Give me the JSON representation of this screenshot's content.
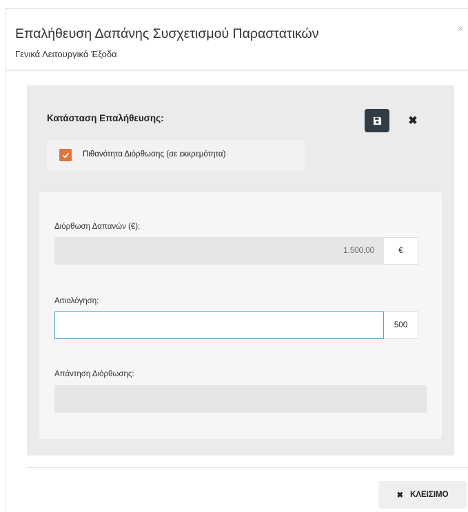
{
  "dialog": {
    "title": "Επαλήθευση Δαπάνης Συσχετισμού Παραστατικών",
    "subtitle": "Γενικά Λειτουργικά Έξοδα",
    "close_glyph": "×"
  },
  "verification": {
    "status_label": "Κατάσταση Επαλήθευσης:",
    "checkbox_label": "Πιθανότητα Διόρθωσης (σε εκκρεμότητα)",
    "checkbox_checked": true,
    "cancel_glyph": "✖"
  },
  "form": {
    "amount_label": "Διόρθωση Δαπανών (€):",
    "amount_value": "1.500,00",
    "currency_addon": "€",
    "reason_label": "Αιτιολόγηση:",
    "reason_value": "",
    "reason_char_limit": "500",
    "reply_label": "Απάντηση Διόρθωσης:",
    "reply_value": ""
  },
  "footer": {
    "close_button_label": "ΚΛΕΙΣΙΜΟ",
    "close_button_glyph": "✖"
  },
  "colors": {
    "accent_checkbox": "#e2743a",
    "save_button": "#2f3c46",
    "focus_border": "#4fa3d9"
  }
}
